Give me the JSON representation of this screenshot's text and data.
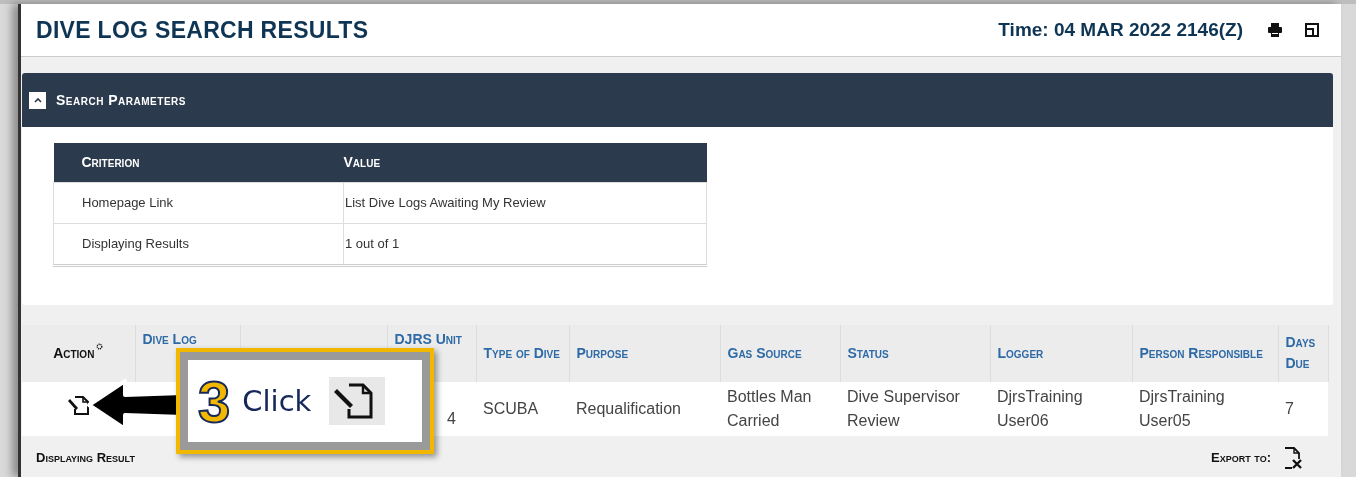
{
  "page": {
    "title": "DIVE LOG SEARCH RESULTS",
    "time": "Time: 04 MAR 2022 2146(Z)"
  },
  "search_parameters": {
    "title": "Search Parameters",
    "expanded": true,
    "columns": [
      "Criterion",
      "Value"
    ],
    "rows": [
      [
        "Homepage Link",
        "List Dive Logs Awaiting My Review"
      ],
      [
        "Displaying Results",
        "1 out of 1"
      ]
    ]
  },
  "results": {
    "columns": [
      "Action",
      "Dive Log",
      "",
      "DJRS Unit",
      "Type of Dive",
      "Purpose",
      "Gas Source",
      "Status",
      "Logger",
      "Person Responsible",
      "Days Due"
    ],
    "rows": [
      {
        "cells": [
          "",
          "",
          "",
          "4",
          "SCUBA",
          "Requalification",
          "Bottles Man Carried",
          "Dive Supervisor Review",
          "DjrsTraining User06",
          "DjrsTraining User05",
          "7"
        ]
      }
    ],
    "footer": "Displaying Result",
    "export_label": "Export to:"
  },
  "callout": {
    "step": "3",
    "text": "Click"
  }
}
